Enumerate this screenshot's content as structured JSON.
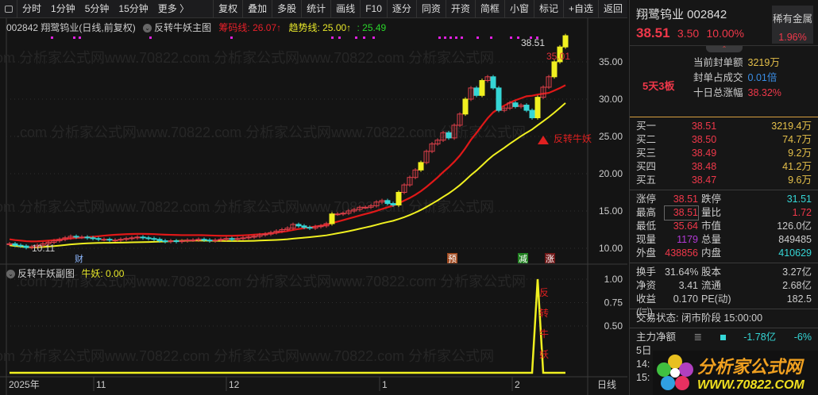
{
  "toolbar": {
    "left": [
      "分时",
      "1分钟",
      "5分钟",
      "15分钟",
      "更多 〉"
    ],
    "right": [
      "复权",
      "叠加",
      "多股",
      "统计",
      "画线",
      "F10",
      "逐分",
      "同资",
      "开资",
      "简框",
      "小窗",
      "标记",
      "+自选",
      "返回"
    ]
  },
  "main_info": {
    "title": "002842 翔鹭钨业(日线,前复权)",
    "indicator": "反转牛妖主图",
    "chip_label": "筹码线: 26.07↑",
    "trend_label": "趋势线: 25.00↑",
    "extra_label": ": 25.49"
  },
  "sub_info": {
    "indicator": "反转牛妖副图",
    "value_label": "牛妖: 0.00"
  },
  "markers": {
    "high_price": "38.51",
    "mid_price": "35.01",
    "low_price": "10.11",
    "signal": "反转牛妖",
    "fin": "财",
    "pre": "预",
    "reduce": "减",
    "up": "涨",
    "sub_signal": [
      "反",
      "转",
      "牛",
      "妖"
    ]
  },
  "axes": {
    "price_ticks": [
      "35.00",
      "30.00",
      "25.00",
      "20.00",
      "15.00",
      "10.00"
    ],
    "sub_ticks": [
      "1.00",
      "0.75",
      "0.50"
    ],
    "time_labels": [
      "2025年",
      "11",
      "12",
      "1",
      "2"
    ],
    "period": "日线"
  },
  "chart_data": {
    "type": "candlestick",
    "closes": [
      10.6,
      10.4,
      10.3,
      10.1,
      10.2,
      10.4,
      10.6,
      10.8,
      11.0,
      11.2,
      11.4,
      11.6,
      11.5,
      11.5,
      11.4,
      11.3,
      11.2,
      11.2,
      11.1,
      11.1,
      11.2,
      11.3,
      11.4,
      11.5,
      11.4,
      11.3,
      11.2,
      11.0,
      10.9,
      11.0,
      10.9,
      11.0,
      11.1,
      11.1,
      11.2,
      11.1,
      11.0,
      11.1,
      11.2,
      11.3,
      11.2,
      11.3,
      11.4,
      11.5,
      11.6,
      11.8,
      11.9,
      12.1,
      12.3,
      12.5,
      12.7,
      13.2,
      13.0,
      12.8,
      12.7,
      12.9,
      13.0,
      13.3,
      14.6,
      14.6,
      14.7,
      15.0,
      15.2,
      15.5,
      15.5,
      15.7,
      16.2,
      16.4,
      16.0,
      15.8,
      17.5,
      18.5,
      19.5,
      20.5,
      21.5,
      23.0,
      24.0,
      24.5,
      25.5,
      24.8,
      26.5,
      28.0,
      30.0,
      31.5,
      30.5,
      32.5,
      33.0,
      31.5,
      28.5,
      28.8,
      29.5,
      29.0,
      29.2,
      28.5,
      27.5,
      30.25,
      31.6,
      33.0,
      35.01,
      37.0,
      38.51
    ],
    "limit_up_bars": [
      58,
      70,
      74,
      82,
      85,
      95,
      98,
      99,
      100
    ],
    "sub_series_peak_bar": 95,
    "price_range": [
      10,
      38.51
    ]
  },
  "stock": {
    "name": "翔鹭钨业 002842",
    "price": "38.51",
    "change": "3.50",
    "pct": "10.00%",
    "sector": "稀有金属",
    "sector_pct": "1.96%",
    "streak": "5天3板",
    "seal": [
      {
        "k": "当前封单额",
        "v": "3219万"
      },
      {
        "k": "封单占成交",
        "v": "0.01倍"
      },
      {
        "k": "十日总涨幅",
        "v": "38.32%"
      }
    ],
    "bids": [
      {
        "k": "买一",
        "p": "38.51",
        "v": "3219.4万"
      },
      {
        "k": "买二",
        "p": "38.50",
        "v": "74.7万"
      },
      {
        "k": "买三",
        "p": "38.49",
        "v": "9.2万"
      },
      {
        "k": "买四",
        "p": "38.48",
        "v": "41.2万"
      },
      {
        "k": "买五",
        "p": "38.47",
        "v": "9.6万"
      }
    ],
    "stats1": [
      [
        "涨停",
        "38.51",
        "跌停",
        "31.51"
      ],
      [
        "最高",
        "38.51",
        "量比",
        "1.72"
      ],
      [
        "最低",
        "35.64",
        "市值",
        "126.0亿"
      ],
      [
        "现量",
        "1179",
        "总量",
        "849485"
      ],
      [
        "外盘",
        "438856",
        "内盘",
        "410629"
      ]
    ],
    "stats2": [
      [
        "换手",
        "31.64%",
        "股本",
        "3.27亿"
      ],
      [
        "净资",
        "3.41",
        "流通",
        "2.68亿"
      ],
      [
        "收益(㈢)",
        "0.170",
        "PE(动)",
        "182.5"
      ]
    ],
    "status": "交易状态: 闭市阶段 15:00:00",
    "main_flow": {
      "label": "主力净额",
      "value": "-1.78亿",
      "pct": "-6%"
    },
    "five_day": "5日",
    "times": [
      "14:",
      "15:"
    ]
  },
  "logo": {
    "cn": "分析家公式网",
    "url": "WWW.70822.COM"
  }
}
